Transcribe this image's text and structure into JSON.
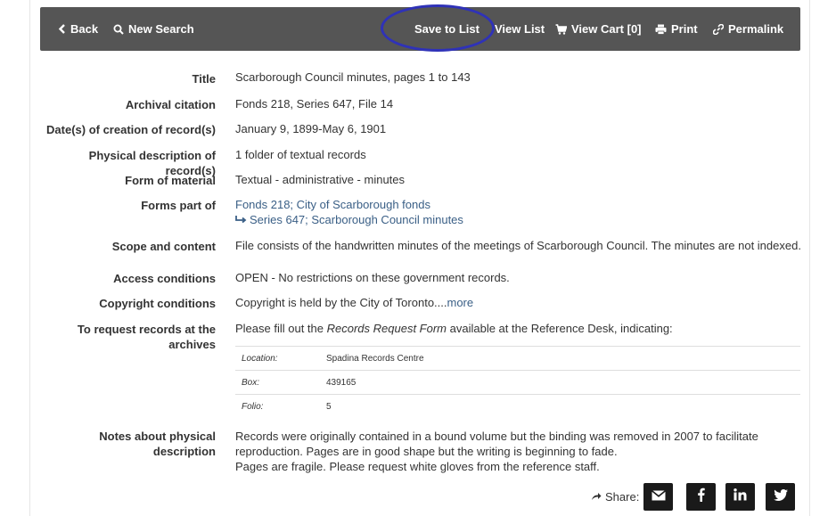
{
  "toolbar": {
    "back": "Back",
    "new_search": "New Search",
    "save_to_list": "Save to List",
    "view_list": "View List",
    "view_cart": "View Cart [0]",
    "print": "Print",
    "permalink": "Permalink"
  },
  "record": {
    "title_label": "Title",
    "title": "Scarborough Council minutes, pages 1 to 143",
    "citation_label": "Archival citation",
    "citation": "Fonds 218, Series 647, File 14",
    "dates_label": "Date(s) of creation of record(s)",
    "dates": "January 9, 1899-May 6, 1901",
    "physical_label": "Physical description of record(s)",
    "physical": "1 folder of textual records",
    "form_label": "Form of material",
    "form": "Textual - administrative - minutes",
    "part_of_label": "Forms part of",
    "part_of_fonds": "Fonds 218; City of Scarborough fonds",
    "part_of_series": "Series 647; Scarborough Council minutes",
    "scope_label": "Scope and content",
    "scope": "File consists of the handwritten minutes of the meetings of Scarborough Council. The minutes are not indexed.",
    "access_label": "Access conditions",
    "access": "OPEN - No restrictions on these government records.",
    "copyright_label": "Copyright conditions",
    "copyright": "Copyright is held by the City of Toronto....",
    "copyright_more": "more",
    "request_label_1": "To request records at the",
    "request_label_2": "archives",
    "request_pre": "Please fill out the ",
    "request_form": "Records Request Form",
    "request_post": " available at the Reference Desk, indicating:",
    "location_rows": [
      {
        "key": "Location:",
        "value": "Spadina Records Centre"
      },
      {
        "key": "Box:",
        "value": "439165"
      },
      {
        "key": "Folio:",
        "value": "5"
      }
    ],
    "notes_label_1": "Notes about physical",
    "notes_label_2": "description",
    "notes_1": "Records were originally contained in a bound volume but the binding was removed in 2007 to facilitate",
    "notes_2": "reproduction. Pages are in good shape but the writing is beginning to fade.",
    "notes_3": "Pages are fragile. Please request white gloves from the reference staff."
  },
  "share": {
    "label": "Share:",
    "buttons": [
      "email-icon",
      "facebook-icon",
      "linkedin-icon",
      "twitter-icon"
    ]
  },
  "colors": {
    "toolbar_bg": "#555555",
    "link": "#3a5f86",
    "highlight_ring": "#2f32b8"
  }
}
